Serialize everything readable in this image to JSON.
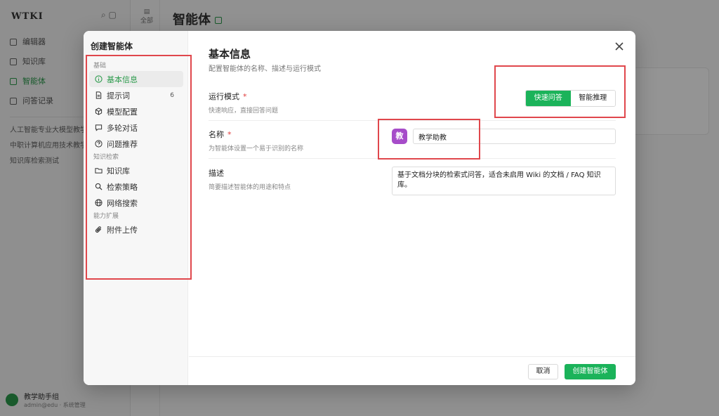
{
  "background": {
    "logo": "WTKI",
    "nav": [
      "编辑器",
      "知识库",
      "智能体",
      "问答记录"
    ],
    "active_nav_index": 2,
    "recent": [
      "人工智能专业大模型教学",
      "中职计算机应用技术教学",
      "知识库检索测试"
    ],
    "page_title": "智能体",
    "rail_label": "全部",
    "user_name": "教学助手组",
    "user_sub": "admin@edu · 系统管理"
  },
  "modal": {
    "title": "创建智能体",
    "sections": [
      {
        "label": "基础",
        "items": [
          {
            "label": "基本信息",
            "icon": "info-icon",
            "active": true
          },
          {
            "label": "提示词",
            "icon": "file-text-icon",
            "count": "6"
          },
          {
            "label": "模型配置",
            "icon": "cube-icon"
          },
          {
            "label": "多轮对话",
            "icon": "chat-icon"
          },
          {
            "label": "问题推荐",
            "icon": "help-circle-icon"
          }
        ]
      },
      {
        "label": "知识检索",
        "items": [
          {
            "label": "知识库",
            "icon": "folder-icon"
          },
          {
            "label": "检索策略",
            "icon": "search-icon"
          },
          {
            "label": "网络搜索",
            "icon": "globe-icon"
          }
        ]
      },
      {
        "label": "能力扩展",
        "items": [
          {
            "label": "附件上传",
            "icon": "paperclip-icon"
          }
        ]
      }
    ],
    "header": {
      "title": "基本信息",
      "subtitle": "配置智能体的名称、描述与运行模式"
    },
    "mode": {
      "label": "运行模式",
      "hint": "快速响应，直接回答问题",
      "options": [
        "快速问答",
        "智能推理"
      ],
      "selected_index": 0
    },
    "name": {
      "label": "名称",
      "hint": "为智能体设置一个易于识别的名称",
      "icon_char": "教",
      "value": "教学助教"
    },
    "description": {
      "label": "描述",
      "hint": "简要描述智能体的用途和特点",
      "value": "基于文档分块的检索式问答，适合未启用 Wiki 的文档 / FAQ 知识库。"
    },
    "footer": {
      "cancel": "取消",
      "create": "创建智能体"
    }
  },
  "colors": {
    "accent": "#1bb35a",
    "active_text": "#2c9b4c",
    "agent_icon": "#a64cc9",
    "annotation": "#e0474c",
    "required": "#e03a3a"
  }
}
